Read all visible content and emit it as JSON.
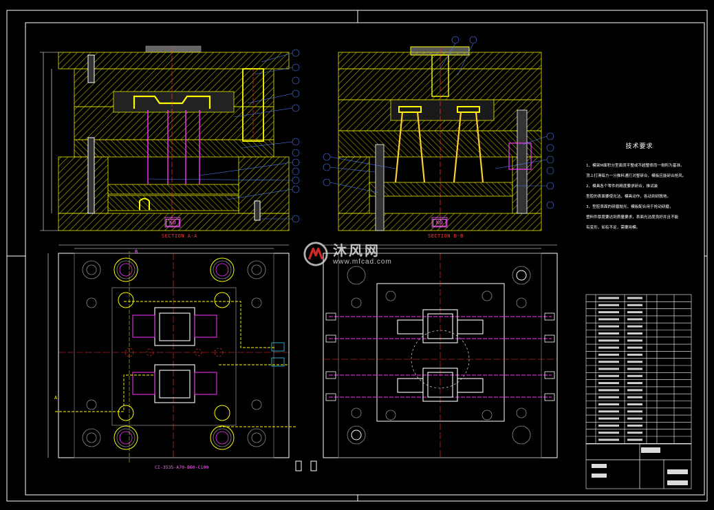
{
  "drawing": {
    "section_a_label": "SECTION A-A",
    "section_b_label": "SECTION B-B",
    "mold_base_spec": "CI-3535-A70-B60-C100",
    "section_marker_a": "A",
    "section_marker_b": "B",
    "kd_a": "KO",
    "kd_b": "KO"
  },
  "watermark": {
    "brand_cn": "沐风网",
    "url": "www.mfcad.com"
  },
  "technical_requirements": {
    "title": "技术要求",
    "lines": [
      "1、模架M面积分型面须平整或不超整修而一侧所为基准。",
      "  顶上打滑每方一分推料通打对整研合，模板应能研合抢风。",
      "2、模具各个零件的精度要求研合，推试装",
      "  型腔的表面要使光洁，模具动作，各动到研脱地。",
      "3、型腔表面的研磨抛光，模板配合用于抢动研磨，",
      "  塑料件厚度要达到质量要求，表面光洁度良好并且不能",
      "  有变形，如有不足，需要用模。"
    ]
  },
  "colors": {
    "frame": "#ffffff",
    "hatch": "#d4d400",
    "outline": "#e6e600",
    "magenta": "#ff33ff",
    "cyan": "#33ccff",
    "red": "#ff3333",
    "gray": "#8a8a8a",
    "balloon": "#4d7dff"
  }
}
